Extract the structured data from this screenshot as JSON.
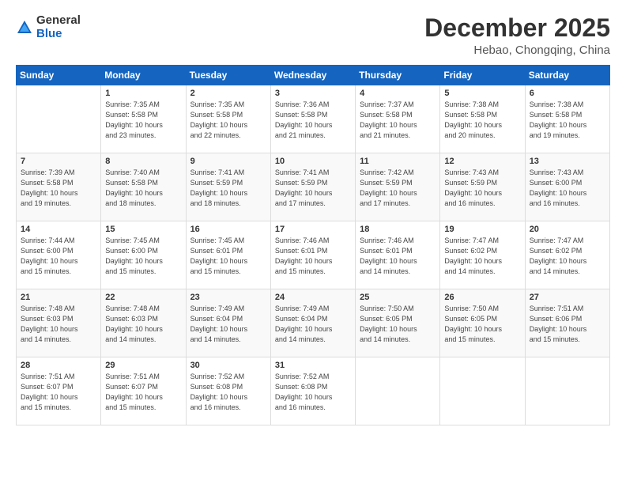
{
  "logo": {
    "general": "General",
    "blue": "Blue"
  },
  "title": "December 2025",
  "subtitle": "Hebao, Chongqing, China",
  "days_header": [
    "Sunday",
    "Monday",
    "Tuesday",
    "Wednesday",
    "Thursday",
    "Friday",
    "Saturday"
  ],
  "weeks": [
    [
      {
        "day": "",
        "info": ""
      },
      {
        "day": "1",
        "info": "Sunrise: 7:35 AM\nSunset: 5:58 PM\nDaylight: 10 hours\nand 23 minutes."
      },
      {
        "day": "2",
        "info": "Sunrise: 7:35 AM\nSunset: 5:58 PM\nDaylight: 10 hours\nand 22 minutes."
      },
      {
        "day": "3",
        "info": "Sunrise: 7:36 AM\nSunset: 5:58 PM\nDaylight: 10 hours\nand 21 minutes."
      },
      {
        "day": "4",
        "info": "Sunrise: 7:37 AM\nSunset: 5:58 PM\nDaylight: 10 hours\nand 21 minutes."
      },
      {
        "day": "5",
        "info": "Sunrise: 7:38 AM\nSunset: 5:58 PM\nDaylight: 10 hours\nand 20 minutes."
      },
      {
        "day": "6",
        "info": "Sunrise: 7:38 AM\nSunset: 5:58 PM\nDaylight: 10 hours\nand 19 minutes."
      }
    ],
    [
      {
        "day": "7",
        "info": "Sunrise: 7:39 AM\nSunset: 5:58 PM\nDaylight: 10 hours\nand 19 minutes."
      },
      {
        "day": "8",
        "info": "Sunrise: 7:40 AM\nSunset: 5:58 PM\nDaylight: 10 hours\nand 18 minutes."
      },
      {
        "day": "9",
        "info": "Sunrise: 7:41 AM\nSunset: 5:59 PM\nDaylight: 10 hours\nand 18 minutes."
      },
      {
        "day": "10",
        "info": "Sunrise: 7:41 AM\nSunset: 5:59 PM\nDaylight: 10 hours\nand 17 minutes."
      },
      {
        "day": "11",
        "info": "Sunrise: 7:42 AM\nSunset: 5:59 PM\nDaylight: 10 hours\nand 17 minutes."
      },
      {
        "day": "12",
        "info": "Sunrise: 7:43 AM\nSunset: 5:59 PM\nDaylight: 10 hours\nand 16 minutes."
      },
      {
        "day": "13",
        "info": "Sunrise: 7:43 AM\nSunset: 6:00 PM\nDaylight: 10 hours\nand 16 minutes."
      }
    ],
    [
      {
        "day": "14",
        "info": "Sunrise: 7:44 AM\nSunset: 6:00 PM\nDaylight: 10 hours\nand 15 minutes."
      },
      {
        "day": "15",
        "info": "Sunrise: 7:45 AM\nSunset: 6:00 PM\nDaylight: 10 hours\nand 15 minutes."
      },
      {
        "day": "16",
        "info": "Sunrise: 7:45 AM\nSunset: 6:01 PM\nDaylight: 10 hours\nand 15 minutes."
      },
      {
        "day": "17",
        "info": "Sunrise: 7:46 AM\nSunset: 6:01 PM\nDaylight: 10 hours\nand 15 minutes."
      },
      {
        "day": "18",
        "info": "Sunrise: 7:46 AM\nSunset: 6:01 PM\nDaylight: 10 hours\nand 14 minutes."
      },
      {
        "day": "19",
        "info": "Sunrise: 7:47 AM\nSunset: 6:02 PM\nDaylight: 10 hours\nand 14 minutes."
      },
      {
        "day": "20",
        "info": "Sunrise: 7:47 AM\nSunset: 6:02 PM\nDaylight: 10 hours\nand 14 minutes."
      }
    ],
    [
      {
        "day": "21",
        "info": "Sunrise: 7:48 AM\nSunset: 6:03 PM\nDaylight: 10 hours\nand 14 minutes."
      },
      {
        "day": "22",
        "info": "Sunrise: 7:48 AM\nSunset: 6:03 PM\nDaylight: 10 hours\nand 14 minutes."
      },
      {
        "day": "23",
        "info": "Sunrise: 7:49 AM\nSunset: 6:04 PM\nDaylight: 10 hours\nand 14 minutes."
      },
      {
        "day": "24",
        "info": "Sunrise: 7:49 AM\nSunset: 6:04 PM\nDaylight: 10 hours\nand 14 minutes."
      },
      {
        "day": "25",
        "info": "Sunrise: 7:50 AM\nSunset: 6:05 PM\nDaylight: 10 hours\nand 14 minutes."
      },
      {
        "day": "26",
        "info": "Sunrise: 7:50 AM\nSunset: 6:05 PM\nDaylight: 10 hours\nand 15 minutes."
      },
      {
        "day": "27",
        "info": "Sunrise: 7:51 AM\nSunset: 6:06 PM\nDaylight: 10 hours\nand 15 minutes."
      }
    ],
    [
      {
        "day": "28",
        "info": "Sunrise: 7:51 AM\nSunset: 6:07 PM\nDaylight: 10 hours\nand 15 minutes."
      },
      {
        "day": "29",
        "info": "Sunrise: 7:51 AM\nSunset: 6:07 PM\nDaylight: 10 hours\nand 15 minutes."
      },
      {
        "day": "30",
        "info": "Sunrise: 7:52 AM\nSunset: 6:08 PM\nDaylight: 10 hours\nand 16 minutes."
      },
      {
        "day": "31",
        "info": "Sunrise: 7:52 AM\nSunset: 6:08 PM\nDaylight: 10 hours\nand 16 minutes."
      },
      {
        "day": "",
        "info": ""
      },
      {
        "day": "",
        "info": ""
      },
      {
        "day": "",
        "info": ""
      }
    ]
  ]
}
